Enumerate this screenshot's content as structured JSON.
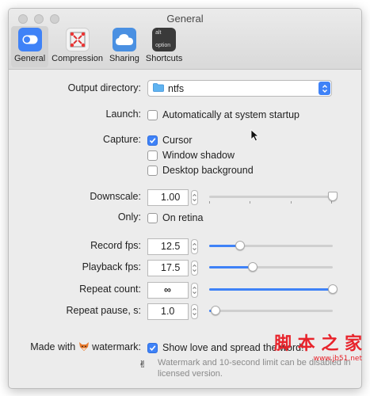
{
  "window": {
    "title": "General"
  },
  "tabs": [
    {
      "label": "General",
      "icon": "toggle-icon",
      "selected": true
    },
    {
      "label": "Compression",
      "icon": "compression-icon",
      "selected": false
    },
    {
      "label": "Sharing",
      "icon": "cloud-icon",
      "selected": false
    },
    {
      "label": "Shortcuts",
      "icon": "keyboard-key-icon",
      "selected": false,
      "key_top": "alt",
      "key_bottom": "option"
    }
  ],
  "output_directory": {
    "label": "Output directory:",
    "value": "ntfs"
  },
  "launch": {
    "label": "Launch:",
    "option": "Automatically at system startup",
    "checked": false
  },
  "capture": {
    "label": "Capture:",
    "options": [
      {
        "text": "Cursor",
        "checked": true
      },
      {
        "text": "Window shadow",
        "checked": false
      },
      {
        "text": "Desktop background",
        "checked": false
      }
    ]
  },
  "downscale": {
    "label": "Downscale:",
    "value": "1.00",
    "slider_fraction": 1.0
  },
  "only": {
    "label": "Only:",
    "option": "On retina",
    "checked": false
  },
  "record_fps": {
    "label": "Record fps:",
    "value": "12.5",
    "slider_fraction": 0.25
  },
  "playback_fps": {
    "label": "Playback fps:",
    "value": "17.5",
    "slider_fraction": 0.35
  },
  "repeat_count": {
    "label": "Repeat count:",
    "value": "∞",
    "slider_fraction": 1.0
  },
  "repeat_pause": {
    "label": "Repeat pause, s:",
    "value": "1.0",
    "slider_fraction": 0.05
  },
  "watermark": {
    "label_before": "Made with",
    "label_icon": "fox-icon",
    "label_after": "watermark:",
    "option": "Show love and spread the word!",
    "checked": true,
    "note": "Watermark and 10-second limit can be disabled in licensed version."
  },
  "site_watermark": {
    "title": "脚 本 之 家",
    "url": "www.jb51.net"
  },
  "colors": {
    "accent": "#3f82f7",
    "watermark_red": "#e8232b"
  }
}
